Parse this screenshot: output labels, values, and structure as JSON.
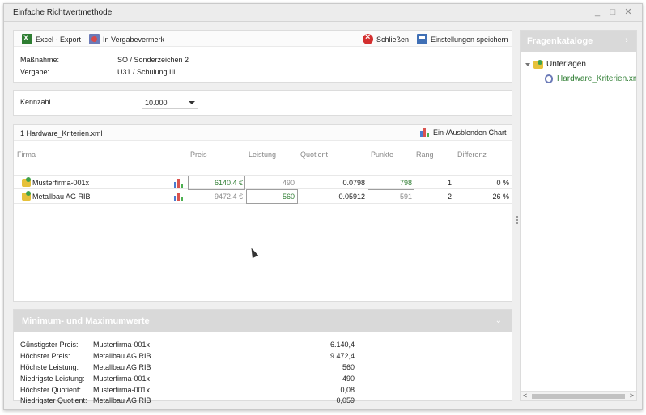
{
  "window": {
    "title": "Einfache Richtwertmethode",
    "controls": [
      "_",
      "□",
      "✕"
    ]
  },
  "toolbar": {
    "excel_export": "Excel - Export",
    "in_vergabevermerk": "In Vergabevermerk",
    "schliessen": "Schließen",
    "einstellungen_speichern": "Einstellungen speichern"
  },
  "info": {
    "massnahme_label": "Maßnahme:",
    "massnahme_value": "SO / Sonderzeichen 2",
    "vergabe_label": "Vergabe:",
    "vergabe_value": "U31 / Schulung III"
  },
  "kennzahl": {
    "label": "Kennzahl",
    "value": "10.000"
  },
  "table": {
    "title": "1 Hardware_Kriterien.xml",
    "toggle_chart": "Ein-/Ausblenden Chart",
    "columns": [
      "Firma",
      "Preis",
      "Leistung",
      "Quotient",
      "Punkte",
      "Rang",
      "Differenz"
    ],
    "rows": [
      {
        "firma": "Musterfirma-001x",
        "preis": "6140.4 €",
        "leistung": "490",
        "quotient": "0.0798",
        "punkte": "798",
        "rang": "1",
        "differenz": "0 %"
      },
      {
        "firma": "Metallbau AG RIB",
        "preis": "9472.4 €",
        "leistung": "560",
        "quotient": "0.05912",
        "punkte": "591",
        "rang": "2",
        "differenz": "26 %"
      }
    ]
  },
  "minmax": {
    "title": "Minimum- und Maximumwerte",
    "items": [
      {
        "label": "Günstigster Preis:",
        "name": "Musterfirma-001x",
        "value": "6.140,4"
      },
      {
        "label": "Höchster Preis:",
        "name": "Metallbau AG RIB",
        "value": "9.472,4"
      },
      {
        "label": "Höchste Leistung:",
        "name": "Metallbau AG RIB",
        "value": "560"
      },
      {
        "label": "Niedrigste Leistung:",
        "name": "Musterfirma-001x",
        "value": "490"
      },
      {
        "label": "Höchster Quotient:",
        "name": "Musterfirma-001x",
        "value": "0,08"
      },
      {
        "label": "Niedrigster Quotient:",
        "name": "Metallbau AG RIB",
        "value": "0,059"
      }
    ]
  },
  "sidebar": {
    "title": "Fragenkataloge",
    "tree_root": "Unterlagen",
    "tree_child": "Hardware_Kriterien.xml"
  },
  "colors": {
    "accent_green": "#2e7d32",
    "header_grey": "#d9d9d9",
    "close_red": "#d32f2f"
  }
}
